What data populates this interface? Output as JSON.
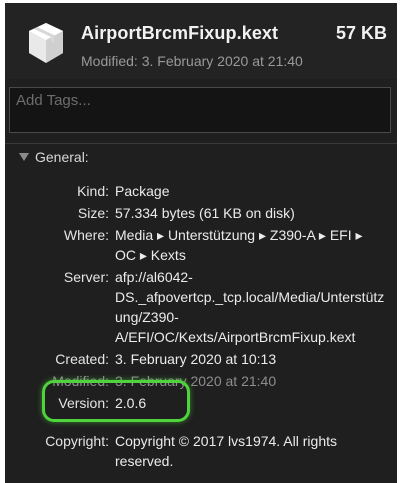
{
  "header": {
    "file_name": "AirportBrcmFixup.kext",
    "file_size": "57 KB",
    "modified_label": "Modified:",
    "modified_value": "3. February 2020 at 21:40",
    "icon": "package-icon"
  },
  "tags": {
    "placeholder": "Add Tags..."
  },
  "general": {
    "title": "General:",
    "rows": {
      "kind": {
        "label": "Kind:",
        "value": "Package"
      },
      "size": {
        "label": "Size:",
        "value": "57.334 bytes (61 KB on disk)"
      },
      "where": {
        "label": "Where:",
        "value": "Media ▸ Unterstützung ▸ Z390-A ▸ EFI ▸ OC ▸ Kexts"
      },
      "server": {
        "label": "Server:",
        "value": "afp://al6042-DS._afpovertcp._tcp.local/Media/Unterstützung/Z390-A/EFI/OC/Kexts/AirportBrcmFixup.kext"
      },
      "created": {
        "label": "Created:",
        "value": "3. February 2020 at 10:13"
      },
      "modified": {
        "label": "Modified:",
        "value": "3. February 2020 at 21:40"
      },
      "version": {
        "label": "Version:",
        "value": "2.0.6"
      },
      "copyright": {
        "label": "Copyright:",
        "value": "Copyright © 2017 lvs1974. All rights reserved."
      }
    }
  },
  "colors": {
    "background": "#1f1f1f",
    "highlight": "#4fd33c"
  }
}
